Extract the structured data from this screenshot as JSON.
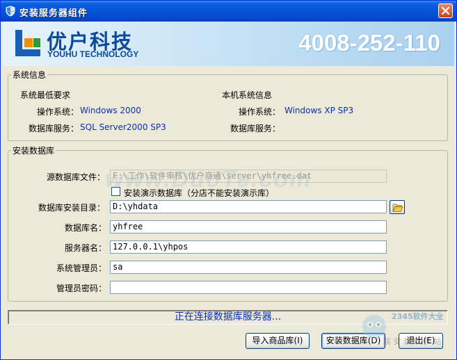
{
  "window": {
    "title": "安装服务器组件"
  },
  "banner": {
    "logo_cn": "优户科技",
    "logo_en": "YOUHU TECHNOLOGY",
    "phone": "4008-252-110"
  },
  "system_info": {
    "legend": "系统信息",
    "min_req_title": "系统最低要求",
    "local_title": "本机系统信息",
    "os_label": "操作系统：",
    "db_label": "数据库服务：",
    "min_os": "Windows 2000",
    "min_db": "SQL Server2000 SP3",
    "local_os": "Windows XP SP3",
    "local_db": ""
  },
  "install_db": {
    "legend": "安装数据库",
    "source_label": "源数据库文件：",
    "source_value": "F:\\工作\\软件审核\\优户商通\\server\\yhfree.dat",
    "demo_checkbox_label": "安装演示数据库（分店不能安装演示库）",
    "demo_checked": false,
    "dir_label": "数据库安装目录：",
    "dir_value": "D:\\yhdata",
    "dbname_label": "数据库名：",
    "dbname_value": "yhfree",
    "server_label": "服务器名：",
    "server_value": "127.0.0.1\\yhpos",
    "admin_label": "系统管理员：",
    "admin_value": "sa",
    "password_label": "管理员密码：",
    "password_value": ""
  },
  "status": {
    "text": "正在连接数据库服务器..."
  },
  "buttons": {
    "import": "导入商品库(I)",
    "install": "安装数据库(D)",
    "exit": "退出(E)"
  },
  "watermark": {
    "text": "www.DuoTe.com",
    "corner": "2345软件大全",
    "corner_sub": "装 安 装 软 件 站"
  },
  "colors": {
    "title_bar": "#0653d8",
    "value_text": "#0a2fb8",
    "banner_brand": "#0a4a9a"
  }
}
